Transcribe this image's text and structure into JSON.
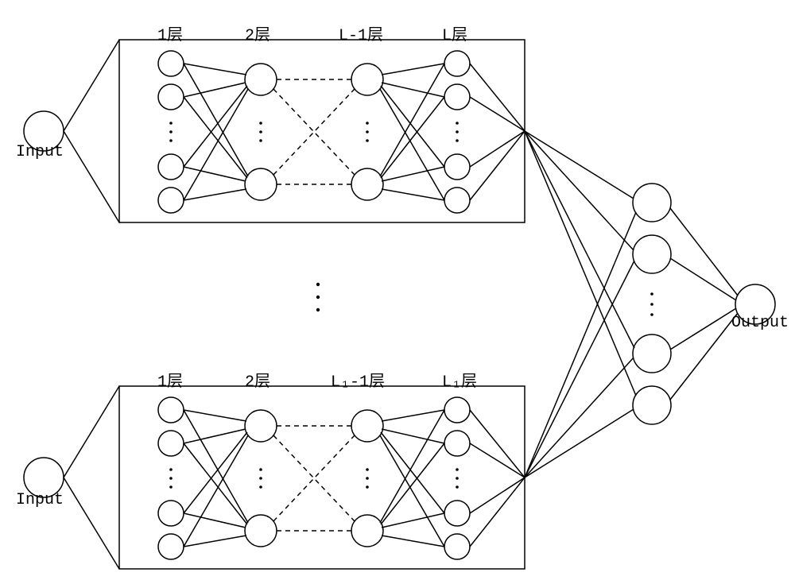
{
  "inputs": {
    "top": "Input",
    "bottom": "Input"
  },
  "output": "Output",
  "top_box_layers": [
    "1层",
    "2层",
    "L-1层",
    "L层"
  ],
  "bottom_box_layers": [
    "1层",
    "2层",
    "L₁-1层",
    "L₁层"
  ],
  "diagram": {
    "type": "neural-network-ensemble",
    "description": "Two stacked multi-layer perceptron blocks, each taking a single Input and expanding through layers; both blocks feed a shared hidden layer that connects to a single Output node. Vertical ellipsis between blocks indicates multiple such networks.",
    "networks_between_blocks": "…",
    "block": {
      "num_layers": "L (top) / L₁ (bottom)",
      "nodes_per_layer": "4 shown with ellipsis (variable)",
      "connections": "fully connected between adjacent shown layers; dashed crossover between layer 2 and layer L-1"
    },
    "aggregator_hidden_nodes": "4 shown with ellipsis (variable)"
  }
}
